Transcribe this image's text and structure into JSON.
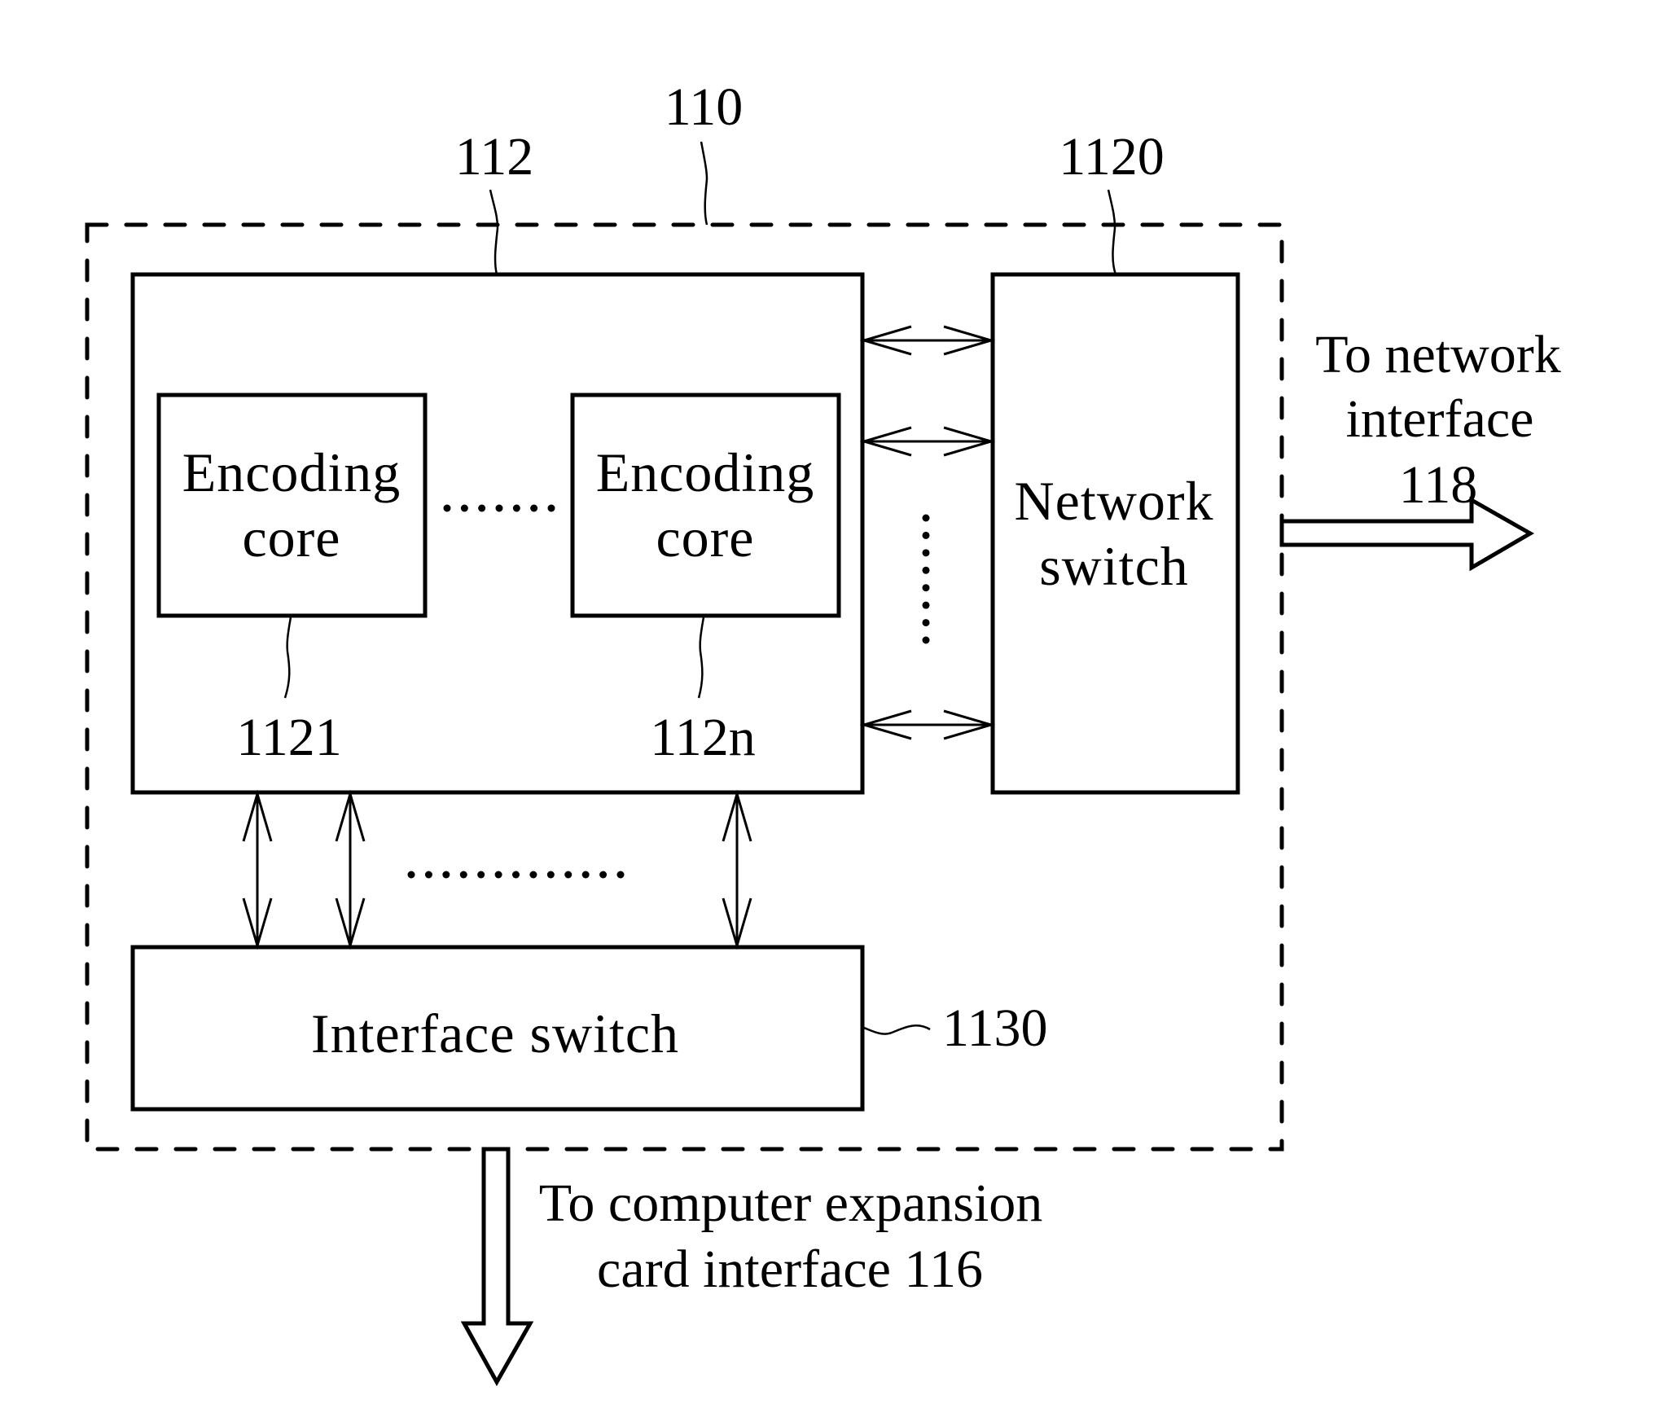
{
  "figure": {
    "system_ref": "110",
    "encoder_block": {
      "ref": "112",
      "cores": [
        {
          "label_line1": "Encoding",
          "label_line2": "core",
          "ref": "1121"
        },
        {
          "label_line1": "Encoding",
          "label_line2": "core",
          "ref": "112n"
        }
      ],
      "core_ellipsis": "......."
    },
    "network_switch": {
      "label_line1": "Network",
      "label_line2": "switch",
      "ref": "1120"
    },
    "interface_switch": {
      "label": "Interface switch",
      "ref": "1130"
    },
    "network_output": {
      "label_line1": "To network",
      "label_line2": "interface",
      "label_line3": "118"
    },
    "expansion_output": {
      "label_line1": "To computer expansion",
      "label_line2": "card interface 116"
    },
    "link_counts": {
      "encoder_to_network_arrows": 3,
      "encoder_to_network_ellipsis_dots": 8,
      "encoder_to_interface_arrows": 3,
      "encoder_to_interface_ellipsis_dots": 13,
      "core_ellipsis_dots": 7
    }
  }
}
